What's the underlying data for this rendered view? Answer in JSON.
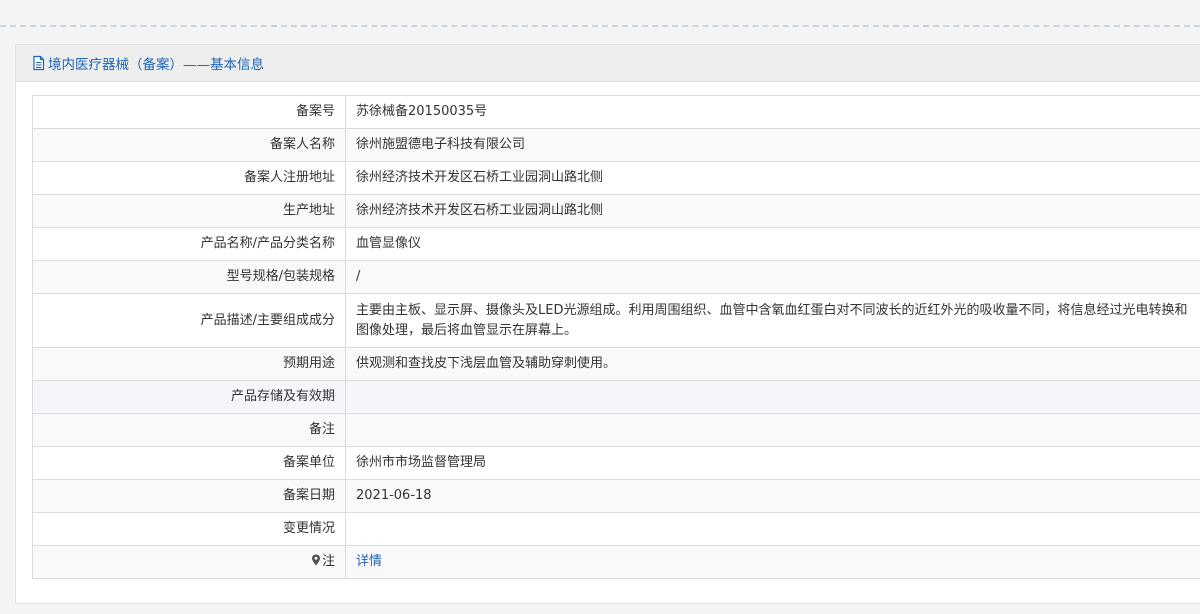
{
  "panel": {
    "title": "境内医疗器械（备案）——基本信息",
    "title_icon": "document-icon",
    "accent_color": "#1d64b8"
  },
  "rows": [
    {
      "label": "备案号",
      "value": "苏徐械备20150035号"
    },
    {
      "label": "备案人名称",
      "value": "徐州施盟德电子科技有限公司"
    },
    {
      "label": "备案人注册地址",
      "value": "徐州经济技术开发区石桥工业园洞山路北侧"
    },
    {
      "label": "生产地址",
      "value": "徐州经济技术开发区石桥工业园洞山路北侧"
    },
    {
      "label": "产品名称/产品分类名称",
      "value": "血管显像仪"
    },
    {
      "label": "型号规格/包装规格",
      "value": "/"
    },
    {
      "label": "产品描述/主要组成成分",
      "value": "主要由主板、显示屏、摄像头及LED光源组成。利用周围组织、血管中含氧血红蛋白对不同波长的近红外光的吸收量不同，将信息经过光电转换和图像处理，最后将血管显示在屏幕上。"
    },
    {
      "label": "预期用途",
      "value": "供观测和查找皮下浅层血管及辅助穿刺使用。"
    },
    {
      "label": "产品存储及有效期",
      "value": ""
    },
    {
      "label": "备注",
      "value": ""
    },
    {
      "label": "备案单位",
      "value": "徐州市市场监督管理局"
    },
    {
      "label": "备案日期",
      "value": "2021-06-18"
    },
    {
      "label": "变更情况",
      "value": ""
    }
  ],
  "note_row": {
    "label": "注",
    "label_icon": "map-pin-icon",
    "link_text": "详情"
  }
}
